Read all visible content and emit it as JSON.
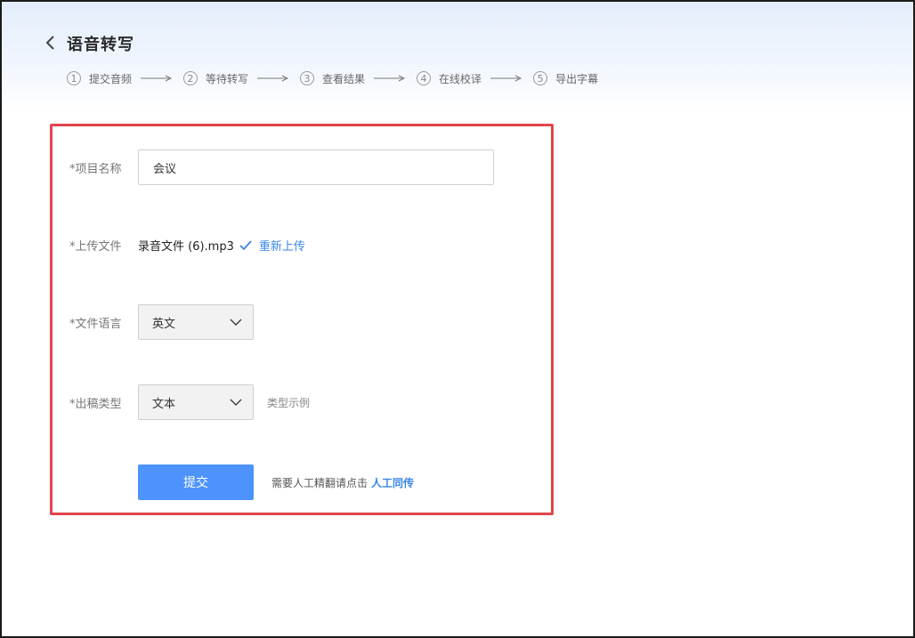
{
  "header": {
    "title": "语音转写",
    "steps": [
      {
        "num": "1",
        "label": "提交音频"
      },
      {
        "num": "2",
        "label": "等待转写"
      },
      {
        "num": "3",
        "label": "查看结果"
      },
      {
        "num": "4",
        "label": "在线校译"
      },
      {
        "num": "5",
        "label": "导出字幕"
      }
    ]
  },
  "form": {
    "project_name": {
      "label": "*项目名称",
      "value": "会议"
    },
    "upload": {
      "label": "*上传文件",
      "file_name": "录音文件 (6).mp3",
      "reupload_label": "重新上传"
    },
    "language": {
      "label": "*文件语言",
      "selected": "英文"
    },
    "output_type": {
      "label": "*出稿类型",
      "selected": "文本",
      "example_label": "类型示例"
    },
    "submit_label": "提交",
    "hint_text": "需要人工精翻请点击",
    "human_link_label": "人工同传"
  },
  "colors": {
    "accent": "#4d93fb",
    "link": "#3a86e8",
    "highlight_border": "#e0454c"
  }
}
